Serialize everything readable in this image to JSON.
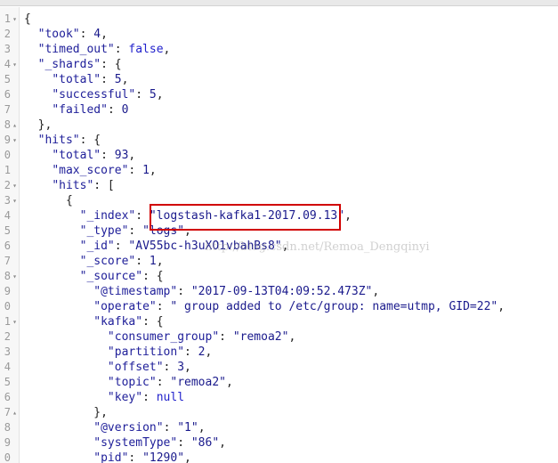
{
  "lines": [
    {
      "n": "1",
      "f": "▾",
      "c": [
        [
          "p",
          "{"
        ]
      ]
    },
    {
      "n": "2",
      "f": "",
      "c": [
        [
          "p",
          "  "
        ],
        [
          "k",
          "\"took\""
        ],
        [
          "p",
          ": "
        ],
        [
          "n",
          "4"
        ],
        [
          "p",
          ","
        ]
      ]
    },
    {
      "n": "3",
      "f": "",
      "c": [
        [
          "p",
          "  "
        ],
        [
          "k",
          "\"timed_out\""
        ],
        [
          "p",
          ": "
        ],
        [
          "b",
          "false"
        ],
        [
          "p",
          ","
        ]
      ]
    },
    {
      "n": "4",
      "f": "▾",
      "c": [
        [
          "p",
          "  "
        ],
        [
          "k",
          "\"_shards\""
        ],
        [
          "p",
          ": {"
        ]
      ]
    },
    {
      "n": "5",
      "f": "",
      "c": [
        [
          "p",
          "    "
        ],
        [
          "k",
          "\"total\""
        ],
        [
          "p",
          ": "
        ],
        [
          "n",
          "5"
        ],
        [
          "p",
          ","
        ]
      ]
    },
    {
      "n": "6",
      "f": "",
      "c": [
        [
          "p",
          "    "
        ],
        [
          "k",
          "\"successful\""
        ],
        [
          "p",
          ": "
        ],
        [
          "n",
          "5"
        ],
        [
          "p",
          ","
        ]
      ]
    },
    {
      "n": "7",
      "f": "",
      "c": [
        [
          "p",
          "    "
        ],
        [
          "k",
          "\"failed\""
        ],
        [
          "p",
          ": "
        ],
        [
          "n",
          "0"
        ]
      ]
    },
    {
      "n": "8",
      "f": "▴",
      "c": [
        [
          "p",
          "  },"
        ]
      ]
    },
    {
      "n": "9",
      "f": "▾",
      "c": [
        [
          "p",
          "  "
        ],
        [
          "k",
          "\"hits\""
        ],
        [
          "p",
          ": {"
        ]
      ]
    },
    {
      "n": "0",
      "f": "",
      "c": [
        [
          "p",
          "    "
        ],
        [
          "k",
          "\"total\""
        ],
        [
          "p",
          ": "
        ],
        [
          "n",
          "93"
        ],
        [
          "p",
          ","
        ]
      ]
    },
    {
      "n": "1",
      "f": "",
      "c": [
        [
          "p",
          "    "
        ],
        [
          "k",
          "\"max_score\""
        ],
        [
          "p",
          ": "
        ],
        [
          "n",
          "1"
        ],
        [
          "p",
          ","
        ]
      ]
    },
    {
      "n": "2",
      "f": "▾",
      "c": [
        [
          "p",
          "    "
        ],
        [
          "k",
          "\"hits\""
        ],
        [
          "p",
          ": ["
        ]
      ]
    },
    {
      "n": "3",
      "f": "▾",
      "c": [
        [
          "p",
          "      {"
        ]
      ]
    },
    {
      "n": "4",
      "f": "",
      "c": [
        [
          "p",
          "        "
        ],
        [
          "k",
          "\"_index\""
        ],
        [
          "p",
          ": "
        ],
        [
          "s",
          "\"logstash-kafka1-2017.09.13\""
        ],
        [
          "p",
          ","
        ]
      ]
    },
    {
      "n": "5",
      "f": "",
      "c": [
        [
          "p",
          "        "
        ],
        [
          "k",
          "\"_type\""
        ],
        [
          "p",
          ": "
        ],
        [
          "s",
          "\"logs\""
        ],
        [
          "p",
          ","
        ]
      ]
    },
    {
      "n": "6",
      "f": "",
      "c": [
        [
          "p",
          "        "
        ],
        [
          "k",
          "\"_id\""
        ],
        [
          "p",
          ": "
        ],
        [
          "s",
          "\"AV55bc-h3uXO1vbahBs8\""
        ],
        [
          "p",
          ","
        ]
      ]
    },
    {
      "n": "7",
      "f": "",
      "c": [
        [
          "p",
          "        "
        ],
        [
          "k",
          "\"_score\""
        ],
        [
          "p",
          ": "
        ],
        [
          "n",
          "1"
        ],
        [
          "p",
          ","
        ]
      ]
    },
    {
      "n": "8",
      "f": "▾",
      "c": [
        [
          "p",
          "        "
        ],
        [
          "k",
          "\"_source\""
        ],
        [
          "p",
          ": {"
        ]
      ]
    },
    {
      "n": "9",
      "f": "",
      "c": [
        [
          "p",
          "          "
        ],
        [
          "k",
          "\"@timestamp\""
        ],
        [
          "p",
          ": "
        ],
        [
          "s",
          "\"2017-09-13T04:09:52.473Z\""
        ],
        [
          "p",
          ","
        ]
      ]
    },
    {
      "n": "0",
      "f": "",
      "c": [
        [
          "p",
          "          "
        ],
        [
          "k",
          "\"operate\""
        ],
        [
          "p",
          ": "
        ],
        [
          "s",
          "\" group added to /etc/group: name=utmp, GID=22\""
        ],
        [
          "p",
          ","
        ]
      ]
    },
    {
      "n": "1",
      "f": "▾",
      "c": [
        [
          "p",
          "          "
        ],
        [
          "k",
          "\"kafka\""
        ],
        [
          "p",
          ": {"
        ]
      ]
    },
    {
      "n": "2",
      "f": "",
      "c": [
        [
          "p",
          "            "
        ],
        [
          "k",
          "\"consumer_group\""
        ],
        [
          "p",
          ": "
        ],
        [
          "s",
          "\"remoa2\""
        ],
        [
          "p",
          ","
        ]
      ]
    },
    {
      "n": "3",
      "f": "",
      "c": [
        [
          "p",
          "            "
        ],
        [
          "k",
          "\"partition\""
        ],
        [
          "p",
          ": "
        ],
        [
          "n",
          "2"
        ],
        [
          "p",
          ","
        ]
      ]
    },
    {
      "n": "4",
      "f": "",
      "c": [
        [
          "p",
          "            "
        ],
        [
          "k",
          "\"offset\""
        ],
        [
          "p",
          ": "
        ],
        [
          "n",
          "3"
        ],
        [
          "p",
          ","
        ]
      ]
    },
    {
      "n": "5",
      "f": "",
      "c": [
        [
          "p",
          "            "
        ],
        [
          "k",
          "\"topic\""
        ],
        [
          "p",
          ": "
        ],
        [
          "s",
          "\"remoa2\""
        ],
        [
          "p",
          ","
        ]
      ]
    },
    {
      "n": "6",
      "f": "",
      "c": [
        [
          "p",
          "            "
        ],
        [
          "k",
          "\"key\""
        ],
        [
          "p",
          ": "
        ],
        [
          "b",
          "null"
        ]
      ]
    },
    {
      "n": "7",
      "f": "▴",
      "c": [
        [
          "p",
          "          },"
        ]
      ]
    },
    {
      "n": "8",
      "f": "",
      "c": [
        [
          "p",
          "          "
        ],
        [
          "k",
          "\"@version\""
        ],
        [
          "p",
          ": "
        ],
        [
          "s",
          "\"1\""
        ],
        [
          "p",
          ","
        ]
      ]
    },
    {
      "n": "9",
      "f": "",
      "c": [
        [
          "p",
          "          "
        ],
        [
          "k",
          "\"systemType\""
        ],
        [
          "p",
          ": "
        ],
        [
          "s",
          "\"86\""
        ],
        [
          "p",
          ","
        ]
      ]
    },
    {
      "n": "0",
      "f": "",
      "c": [
        [
          "p",
          "          "
        ],
        [
          "k",
          "\"pid\""
        ],
        [
          "p",
          ": "
        ],
        [
          "s",
          "\"1290\""
        ],
        [
          "p",
          ","
        ]
      ]
    }
  ],
  "watermark": "http://blog.csdn.net/Remoa_Dengqinyi"
}
